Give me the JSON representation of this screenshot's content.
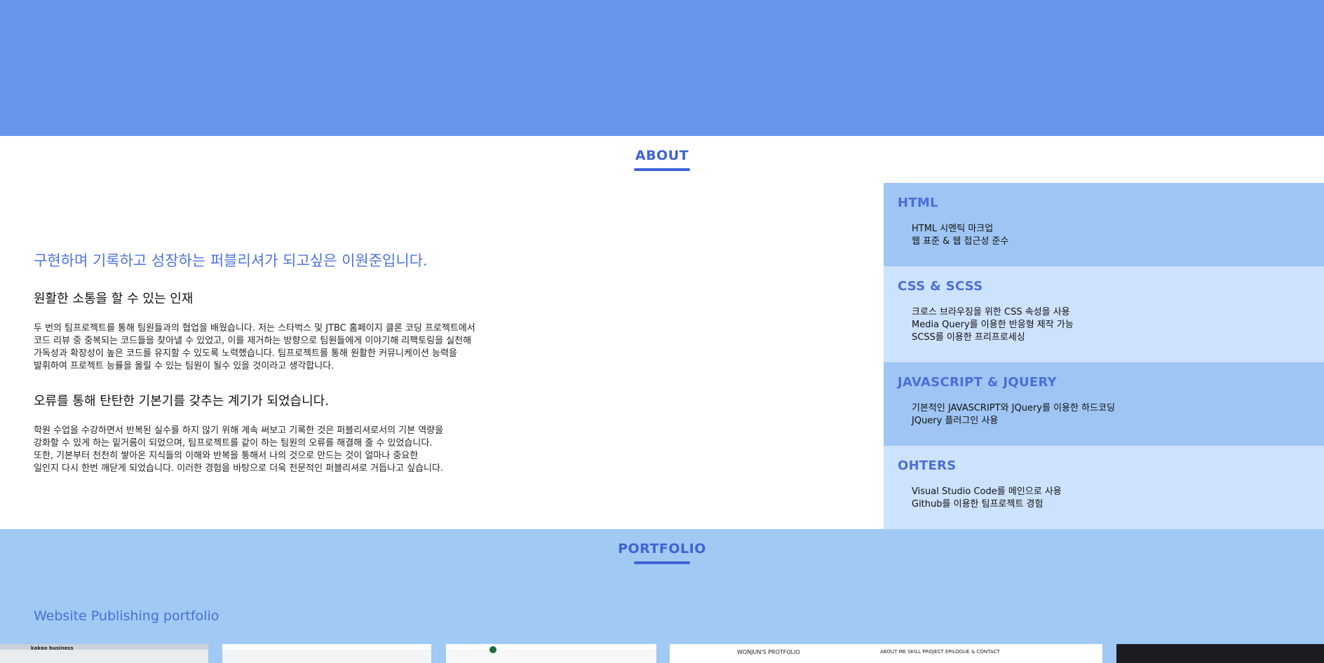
{
  "about": {
    "title": "ABOUT",
    "headline": "구현하며 기록하고 성장하는 퍼블리셔가 되고싶은 이원준입니다.",
    "subhead1": "원활한 소통을 할 수 있는 인재",
    "para1": "두 번의 팀프로젝트를 통해 팀원들과의 협업을 배웠습니다. 저는 스타벅스 및 JTBC 홈페이지 클론 코딩 프로젝트에서\n코드 리뷰 중 중복되는 코드들을 찾아낼 수 있었고, 이를 제거하는 방향으로 팀원들에게 이야기해 리팩토링을 실천해\n가독성과 확장성이 높은 코드를 유지할 수 있도록 노력했습니다. 팀프로젝트를 통해 원활한 커뮤니케이션 능력을\n발휘하여 프로젝트 능률을 올릴 수 있는 팀원이 될수 있을 것이라고 생각합니다.",
    "subhead2": "오류를 통해 탄탄한 기본기를 갖추는 계기가 되었습니다.",
    "para2": "학원 수업을 수강하면서 반복된 실수를 하지 않기 위해 계속 써보고 기록한 것은 퍼블리셔로서의 기본 역량을\n강화할 수 있게 하는 밑거름이 되었으며, 팀프로젝트를 같이 하는 팀원의 오류를 해결해 줄 수 있었습니다.\n또한, 기본부터 천천히 쌓아온 지식들의 이해와 반복을 통해서 나의 것으로 만드는 것이 얼마나 중요한\n일인지 다시 한번 깨닫게 되었습니다. 이러한 경험을 바탕으로 더욱 전문적인 퍼블리셔로 거듭나고 싶습니다."
  },
  "skills": [
    {
      "title": "HTML",
      "items": [
        "HTML 시멘틱 마크업",
        "웹 표준 & 웹 접근성 준수"
      ]
    },
    {
      "title": "CSS & SCSS",
      "items": [
        "크로스 브라우징을 위한 CSS 속성을 사용",
        "Media Query를 이용한 반응형 제작 가능",
        "SCSS를 이용한 프리프로세싱"
      ]
    },
    {
      "title": "JAVASCRIPT & JQUERY",
      "items": [
        "기본적인 JAVASCRIPT와 JQuery를 이용한 하드코딩",
        "JQuery 플러그인 사용"
      ]
    },
    {
      "title": "OHTERS",
      "items": [
        "Visual Studio Code를 메인으로 사용",
        "Github를 이용한 팀프로젝트 경험"
      ]
    }
  ],
  "portfolio": {
    "title": "PORTFOLIO",
    "subtitle": "Website Publishing portfolio",
    "thumbs": [
      {
        "label": "kakao business",
        "bar": "#c9d3dc"
      },
      {
        "label": "",
        "bar": "#ffffff"
      },
      {
        "label": "",
        "bar": "#ffffff"
      },
      {
        "label": "WONJUN'S PROTFOLIO",
        "nav": "ABOUT ME    SKILL    PROJECT    EPILOGUE & CONTACT",
        "bar": "#ffffff"
      },
      {
        "label": "",
        "bar": "#1b1d22"
      }
    ]
  }
}
